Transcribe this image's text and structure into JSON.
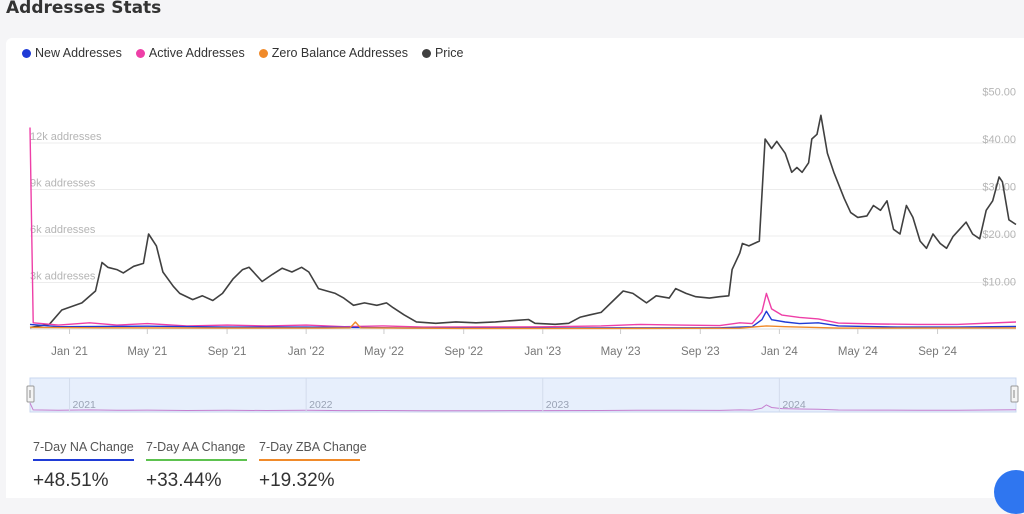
{
  "page": {
    "title": "Addresses Stats"
  },
  "legend": [
    {
      "label": "New Addresses",
      "color": "#1f3bd6"
    },
    {
      "label": "Active Addresses",
      "color": "#ee3fa7"
    },
    {
      "label": "Zero Balance Addresses",
      "color": "#f08a2a"
    },
    {
      "label": "Price",
      "color": "#404040"
    }
  ],
  "chart_data": {
    "type": "line",
    "x_range": [
      "2020-11-01",
      "2024-12-31"
    ],
    "x_ticks": [
      "Jan '21",
      "May '21",
      "Sep '21",
      "Jan '22",
      "May '22",
      "Sep '22",
      "Jan '23",
      "May '23",
      "Sep '23",
      "Jan '24",
      "May '24",
      "Sep '24"
    ],
    "y_left": {
      "ticks": [
        "3k addresses",
        "6k addresses",
        "9k addresses",
        "12k addresses"
      ],
      "range": [
        0,
        15000
      ]
    },
    "y_right": {
      "ticks": [
        "$10.00",
        "$20.00",
        "$30.00",
        "$40.00",
        "$50.00"
      ],
      "range": [
        0,
        50
      ]
    },
    "grid": true,
    "legend_position": "top-left",
    "series": [
      {
        "name": "Price",
        "axis": "right",
        "color": "#404040",
        "points": [
          [
            "2020-11-01",
            0.3
          ],
          [
            "2020-12-01",
            1.0
          ],
          [
            "2020-12-20",
            4.0
          ],
          [
            "2021-01-20",
            5.5
          ],
          [
            "2021-02-10",
            8.0
          ],
          [
            "2021-02-20",
            14.0
          ],
          [
            "2021-03-01",
            13.0
          ],
          [
            "2021-03-15",
            12.5
          ],
          [
            "2021-03-25",
            11.8
          ],
          [
            "2021-04-10",
            13.2
          ],
          [
            "2021-04-25",
            13.8
          ],
          [
            "2021-05-03",
            20.0
          ],
          [
            "2021-05-15",
            17.5
          ],
          [
            "2021-05-25",
            12.0
          ],
          [
            "2021-06-10",
            9.0
          ],
          [
            "2021-06-20",
            7.5
          ],
          [
            "2021-07-10",
            6.2
          ],
          [
            "2021-07-25",
            7.0
          ],
          [
            "2021-08-10",
            6.0
          ],
          [
            "2021-08-25",
            7.5
          ],
          [
            "2021-09-10",
            10.5
          ],
          [
            "2021-09-25",
            12.5
          ],
          [
            "2021-10-05",
            13.0
          ],
          [
            "2021-10-25",
            10.0
          ],
          [
            "2021-11-10",
            11.5
          ],
          [
            "2021-11-25",
            12.8
          ],
          [
            "2021-12-10",
            12.0
          ],
          [
            "2021-12-25",
            13.0
          ],
          [
            "2022-01-05",
            12.0
          ],
          [
            "2022-01-20",
            8.5
          ],
          [
            "2022-02-15",
            7.5
          ],
          [
            "2022-02-28",
            6.5
          ],
          [
            "2022-03-15",
            5.0
          ],
          [
            "2022-04-01",
            5.5
          ],
          [
            "2022-04-20",
            5.0
          ],
          [
            "2022-05-05",
            5.5
          ],
          [
            "2022-05-15",
            4.5
          ],
          [
            "2022-06-01",
            3.0
          ],
          [
            "2022-06-20",
            1.5
          ],
          [
            "2022-07-20",
            1.2
          ],
          [
            "2022-08-20",
            1.5
          ],
          [
            "2022-09-20",
            1.3
          ],
          [
            "2022-10-20",
            1.5
          ],
          [
            "2022-11-20",
            1.8
          ],
          [
            "2022-12-10",
            2.0
          ],
          [
            "2022-12-20",
            1.2
          ],
          [
            "2023-01-20",
            1.0
          ],
          [
            "2023-02-10",
            1.2
          ],
          [
            "2023-02-28",
            2.5
          ],
          [
            "2023-03-15",
            3.0
          ],
          [
            "2023-04-01",
            3.5
          ],
          [
            "2023-04-20",
            6.0
          ],
          [
            "2023-05-05",
            8.0
          ],
          [
            "2023-05-20",
            7.5
          ],
          [
            "2023-06-10",
            5.5
          ],
          [
            "2023-06-25",
            7.0
          ],
          [
            "2023-07-15",
            6.5
          ],
          [
            "2023-07-25",
            8.5
          ],
          [
            "2023-08-10",
            7.5
          ],
          [
            "2023-08-25",
            6.8
          ],
          [
            "2023-09-15",
            6.5
          ],
          [
            "2023-10-01",
            6.8
          ],
          [
            "2023-10-15",
            7.0
          ],
          [
            "2023-10-20",
            12.5
          ],
          [
            "2023-11-01",
            16.0
          ],
          [
            "2023-11-05",
            18.0
          ],
          [
            "2023-11-15",
            17.5
          ],
          [
            "2023-12-01",
            18.5
          ],
          [
            "2023-12-10",
            40.0
          ],
          [
            "2023-12-20",
            38.0
          ],
          [
            "2023-12-28",
            39.5
          ],
          [
            "2024-01-10",
            37.0
          ],
          [
            "2024-01-20",
            33.0
          ],
          [
            "2024-01-28",
            34.0
          ],
          [
            "2024-02-05",
            33.0
          ],
          [
            "2024-02-15",
            35.0
          ],
          [
            "2024-02-20",
            40.0
          ],
          [
            "2024-02-28",
            41.0
          ],
          [
            "2024-03-05",
            45.0
          ],
          [
            "2024-03-15",
            37.0
          ],
          [
            "2024-03-25",
            33.0
          ],
          [
            "2024-04-10",
            27.5
          ],
          [
            "2024-04-20",
            24.5
          ],
          [
            "2024-05-01",
            23.5
          ],
          [
            "2024-05-15",
            23.8
          ],
          [
            "2024-05-25",
            26.0
          ],
          [
            "2024-06-05",
            25.0
          ],
          [
            "2024-06-15",
            27.0
          ],
          [
            "2024-06-25",
            21.0
          ],
          [
            "2024-07-05",
            20.0
          ],
          [
            "2024-07-15",
            26.0
          ],
          [
            "2024-07-25",
            23.5
          ],
          [
            "2024-08-05",
            18.5
          ],
          [
            "2024-08-15",
            17.0
          ],
          [
            "2024-08-25",
            20.0
          ],
          [
            "2024-09-05",
            18.0
          ],
          [
            "2024-09-15",
            17.0
          ],
          [
            "2024-09-25",
            19.5
          ],
          [
            "2024-10-05",
            21.0
          ],
          [
            "2024-10-15",
            22.5
          ],
          [
            "2024-10-25",
            20.0
          ],
          [
            "2024-11-05",
            19.0
          ],
          [
            "2024-11-15",
            25.0
          ],
          [
            "2024-11-25",
            27.0
          ],
          [
            "2024-12-05",
            32.0
          ],
          [
            "2024-12-10",
            31.0
          ],
          [
            "2024-12-20",
            23.0
          ],
          [
            "2024-12-31",
            22.0
          ]
        ]
      },
      {
        "name": "Active Addresses",
        "axis": "left",
        "color": "#ee3fa7",
        "points": [
          [
            "2020-11-01",
            13000
          ],
          [
            "2020-11-06",
            400
          ],
          [
            "2020-12-15",
            250
          ],
          [
            "2021-02-01",
            400
          ],
          [
            "2021-03-15",
            250
          ],
          [
            "2021-05-01",
            350
          ],
          [
            "2021-07-01",
            200
          ],
          [
            "2021-09-01",
            250
          ],
          [
            "2021-11-01",
            200
          ],
          [
            "2022-01-01",
            250
          ],
          [
            "2022-03-01",
            150
          ],
          [
            "2022-05-01",
            200
          ],
          [
            "2022-07-01",
            120
          ],
          [
            "2022-10-01",
            130
          ],
          [
            "2023-01-01",
            140
          ],
          [
            "2023-04-01",
            200
          ],
          [
            "2023-06-01",
            300
          ],
          [
            "2023-08-01",
            250
          ],
          [
            "2023-10-01",
            220
          ],
          [
            "2023-11-01",
            400
          ],
          [
            "2023-11-20",
            350
          ],
          [
            "2023-12-05",
            1100
          ],
          [
            "2023-12-12",
            2300
          ],
          [
            "2023-12-20",
            1300
          ],
          [
            "2024-01-05",
            900
          ],
          [
            "2024-02-01",
            750
          ],
          [
            "2024-03-01",
            650
          ],
          [
            "2024-04-01",
            380
          ],
          [
            "2024-06-01",
            320
          ],
          [
            "2024-08-01",
            300
          ],
          [
            "2024-10-01",
            300
          ],
          [
            "2024-12-31",
            450
          ]
        ]
      },
      {
        "name": "New Addresses",
        "axis": "left",
        "color": "#1f3bd6",
        "points": [
          [
            "2020-11-01",
            300
          ],
          [
            "2020-12-15",
            150
          ],
          [
            "2021-05-01",
            180
          ],
          [
            "2021-09-01",
            120
          ],
          [
            "2022-01-01",
            120
          ],
          [
            "2022-06-01",
            70
          ],
          [
            "2022-12-01",
            60
          ],
          [
            "2023-05-01",
            80
          ],
          [
            "2023-10-01",
            80
          ],
          [
            "2023-11-20",
            150
          ],
          [
            "2023-12-05",
            600
          ],
          [
            "2023-12-12",
            1150
          ],
          [
            "2023-12-20",
            600
          ],
          [
            "2024-01-10",
            450
          ],
          [
            "2024-02-01",
            350
          ],
          [
            "2024-03-01",
            400
          ],
          [
            "2024-04-01",
            200
          ],
          [
            "2024-07-01",
            120
          ],
          [
            "2024-10-01",
            120
          ],
          [
            "2024-12-31",
            160
          ]
        ]
      },
      {
        "name": "Zero Balance Addresses",
        "axis": "left",
        "color": "#f08a2a",
        "points": [
          [
            "2020-11-01",
            100
          ],
          [
            "2021-03-01",
            80
          ],
          [
            "2021-09-01",
            60
          ],
          [
            "2022-02-01",
            60
          ],
          [
            "2022-03-10",
            80
          ],
          [
            "2022-03-18",
            450
          ],
          [
            "2022-03-26",
            80
          ],
          [
            "2022-09-01",
            40
          ],
          [
            "2023-05-01",
            40
          ],
          [
            "2023-11-01",
            50
          ],
          [
            "2023-12-12",
            200
          ],
          [
            "2024-01-10",
            150
          ],
          [
            "2024-04-01",
            60
          ],
          [
            "2024-12-31",
            70
          ]
        ]
      }
    ]
  },
  "navigator": {
    "year_labels": [
      "2021",
      "2022",
      "2023",
      "2024"
    ]
  },
  "stats": [
    {
      "label": "7-Day NA Change",
      "value": "+48.51%",
      "color": "#1f3bd6"
    },
    {
      "label": "7-Day AA Change",
      "value": "+33.44%",
      "color": "#5dc24f"
    },
    {
      "label": "7-Day ZBA Change",
      "value": "+19.32%",
      "color": "#f08a2a"
    }
  ]
}
